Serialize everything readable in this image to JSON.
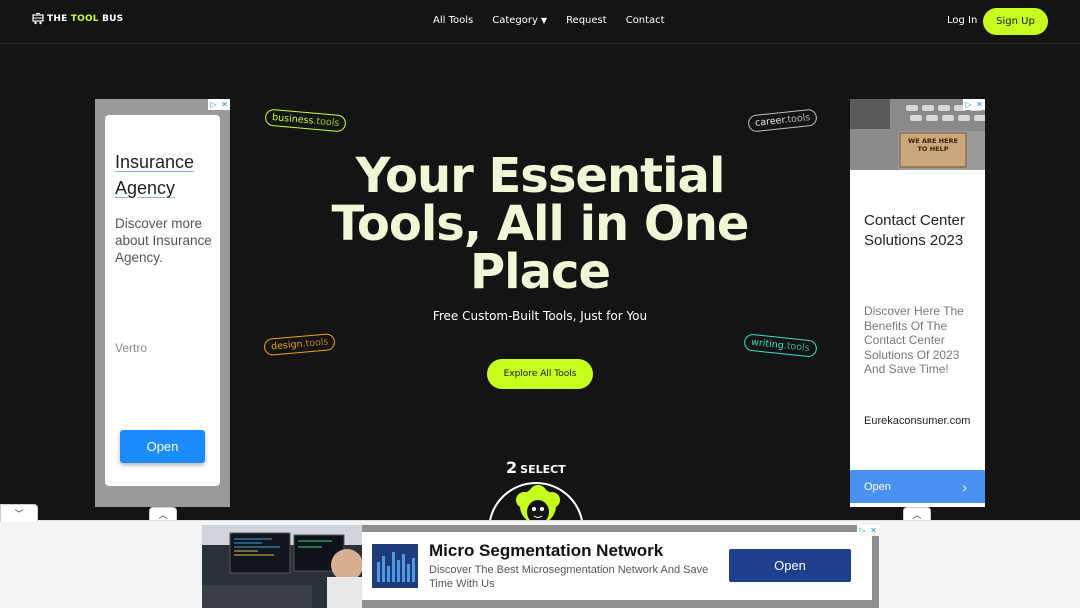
{
  "nav": {
    "logo": {
      "the": "THE ",
      "tool": "TOOL",
      "bus": " BUS"
    },
    "links": {
      "all_tools": "All Tools",
      "category": "Category",
      "request": "Request",
      "contact": "Contact"
    },
    "login": "Log In",
    "signup": "Sign Up"
  },
  "hero": {
    "title": "Your Essential Tools, All in One Place",
    "subtitle": "Free Custom-Built Tools, Just for You",
    "cta": "Explore All Tools",
    "tags": {
      "business": {
        "word": "business",
        "domain": ".tools"
      },
      "career": {
        "word": "career",
        "domain": ".tools"
      },
      "design": {
        "word": "design",
        "domain": ".tools"
      },
      "writing": {
        "word": "writing",
        "domain": ".tools"
      }
    },
    "select_number": "2",
    "select_word": "SELECT"
  },
  "ad_left": {
    "title": "Insurance Agency",
    "description": "Discover more about Insurance Agency.",
    "brand": "Vertro",
    "button": "Open"
  },
  "ad_right": {
    "sign_text": "WE ARE HERE TO HELP",
    "title": "Contact Center Solutions 2023",
    "description": "Discover Here The Benefits Of The Contact Center Solutions Of 2023 And Save Time!",
    "url": "Eurekaconsumer.com",
    "button": "Open"
  },
  "ad_bottom": {
    "title": "Micro Segmentation Network",
    "description": "Discover The Best Microsegmentation Network And Save Time With Us",
    "button": "Open"
  },
  "colors": {
    "accent": "#c6ff1d",
    "background": "#141414",
    "hero_text": "#eef7d6"
  }
}
